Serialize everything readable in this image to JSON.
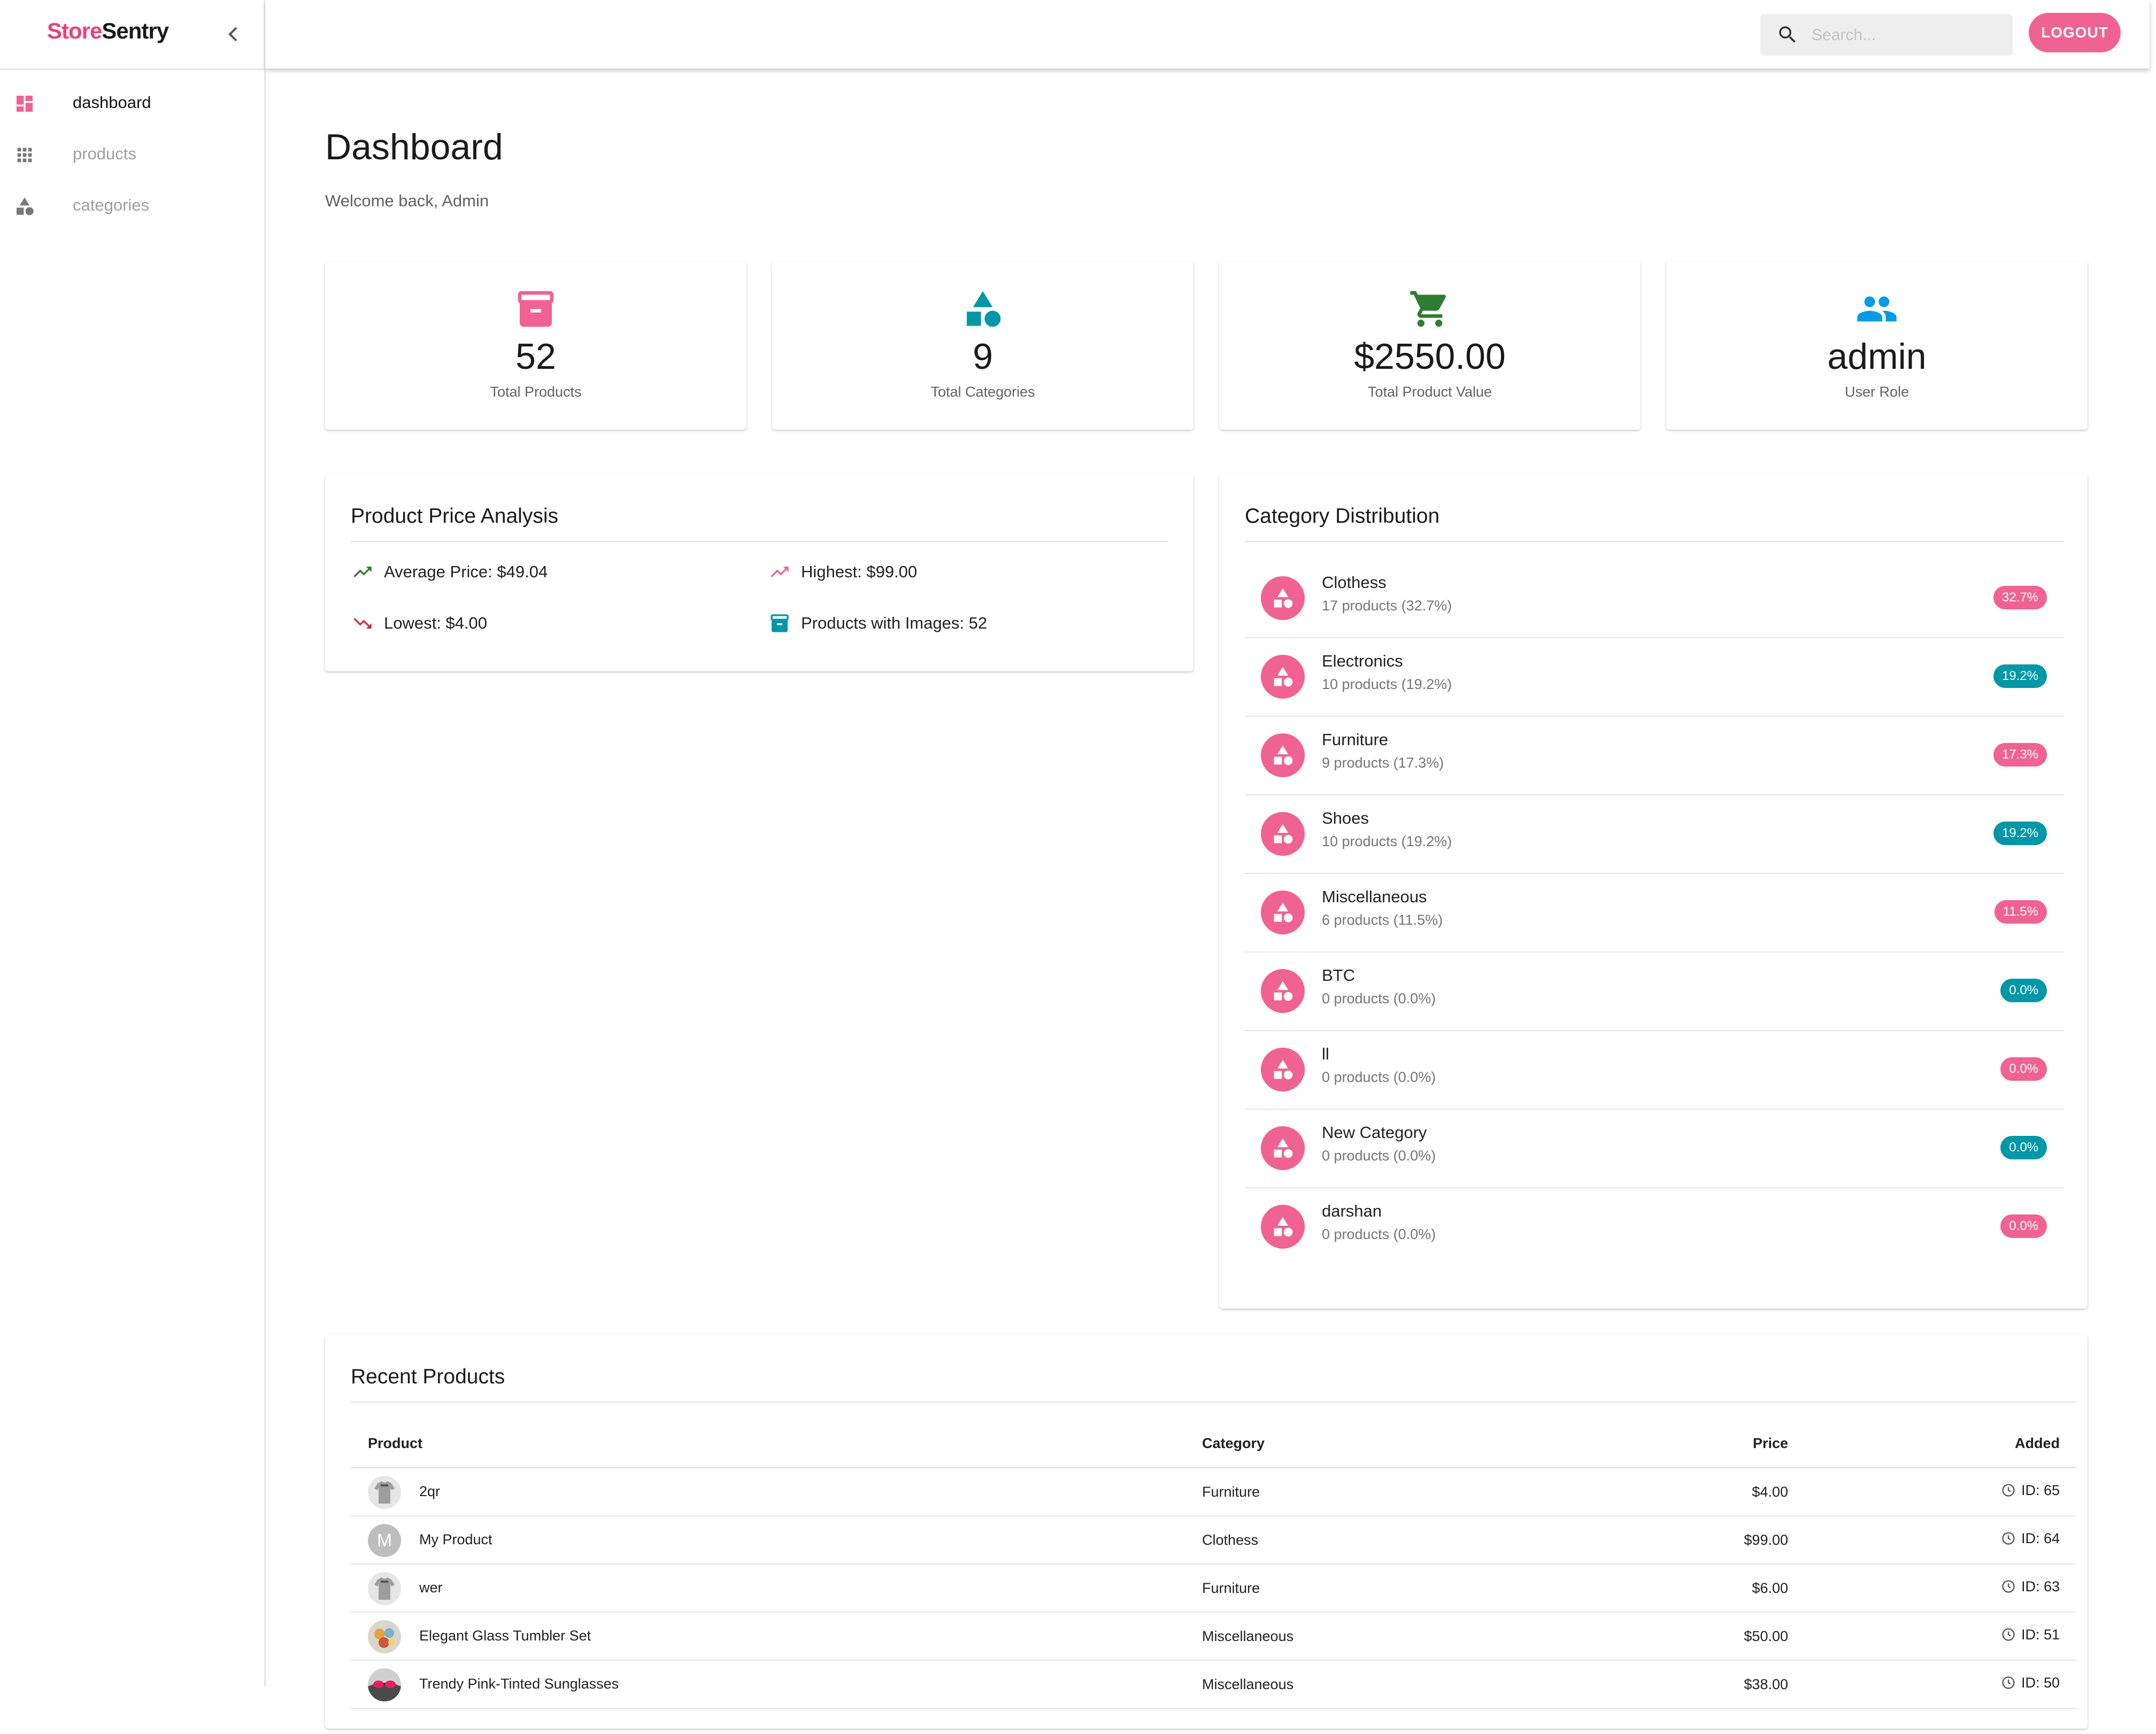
{
  "app": {
    "brand_part1": "Store",
    "brand_part2": "Sentry",
    "accent_color": "#f06292",
    "teal_color": "#0097a7"
  },
  "sidebar": {
    "items": [
      {
        "label": "dashboard",
        "icon": "dashboard-icon",
        "active": true
      },
      {
        "label": "products",
        "icon": "apps-grid-icon",
        "active": false
      },
      {
        "label": "categories",
        "icon": "category-shapes-icon",
        "active": false
      }
    ]
  },
  "topbar": {
    "search_placeholder": "Search...",
    "logout_label": "LOGOUT"
  },
  "header": {
    "title": "Dashboard",
    "welcome": "Welcome back, Admin"
  },
  "stats": [
    {
      "value": "52",
      "label": "Total Products",
      "icon": "inventory-box-icon",
      "color": "#f06292"
    },
    {
      "value": "9",
      "label": "Total Categories",
      "icon": "category-shapes-icon",
      "color": "#0097a7"
    },
    {
      "value": "$2550.00",
      "label": "Total Product Value",
      "icon": "shopping-cart-icon",
      "color": "#2e7d32"
    },
    {
      "value": "admin",
      "label": "User Role",
      "icon": "people-icon",
      "color": "#039be5"
    }
  ],
  "price_analysis": {
    "title": "Product Price Analysis",
    "items": [
      {
        "text": "Average Price: $49.04",
        "icon": "trending-up-icon",
        "color": "#2e7d32"
      },
      {
        "text": "Highest: $99.00",
        "icon": "trending-up-icon",
        "color": "#f06292"
      },
      {
        "text": "Lowest: $4.00",
        "icon": "trending-down-icon",
        "color": "#d32f2f"
      },
      {
        "text": "Products with Images: 52",
        "icon": "inventory-box-icon",
        "color": "#0097a7"
      }
    ]
  },
  "category_distribution": {
    "title": "Category Distribution",
    "items": [
      {
        "name": "Clothess",
        "sub": "17 products (32.7%)",
        "badge": "32.7%",
        "badge_color": "#f06292"
      },
      {
        "name": "Electronics",
        "sub": "10 products (19.2%)",
        "badge": "19.2%",
        "badge_color": "#0097a7"
      },
      {
        "name": "Furniture",
        "sub": "9 products (17.3%)",
        "badge": "17.3%",
        "badge_color": "#f06292"
      },
      {
        "name": "Shoes",
        "sub": "10 products (19.2%)",
        "badge": "19.2%",
        "badge_color": "#0097a7"
      },
      {
        "name": "Miscellaneous",
        "sub": "6 products (11.5%)",
        "badge": "11.5%",
        "badge_color": "#f06292"
      },
      {
        "name": "BTC",
        "sub": "0 products (0.0%)",
        "badge": "0.0%",
        "badge_color": "#0097a7"
      },
      {
        "name": "ll",
        "sub": "0 products (0.0%)",
        "badge": "0.0%",
        "badge_color": "#f06292"
      },
      {
        "name": "New Category",
        "sub": "0 products (0.0%)",
        "badge": "0.0%",
        "badge_color": "#0097a7"
      },
      {
        "name": "darshan",
        "sub": "0 products (0.0%)",
        "badge": "0.0%",
        "badge_color": "#f06292"
      }
    ]
  },
  "recent_products": {
    "title": "Recent Products",
    "columns": {
      "product": "Product",
      "category": "Category",
      "price": "Price",
      "added": "Added"
    },
    "rows": [
      {
        "name": "2qr",
        "category": "Furniture",
        "price": "$4.00",
        "added": "ID: 65",
        "thumb": "tshirt-thumbnail"
      },
      {
        "name": "My Product",
        "category": "Clothess",
        "price": "$99.00",
        "added": "ID: 64",
        "thumb": "letter-avatar",
        "initial": "M"
      },
      {
        "name": "wer",
        "category": "Furniture",
        "price": "$6.00",
        "added": "ID: 63",
        "thumb": "tshirt-thumbnail"
      },
      {
        "name": "Elegant Glass Tumbler Set",
        "category": "Miscellaneous",
        "price": "$50.00",
        "added": "ID: 51",
        "thumb": "tumbler-photo-thumbnail"
      },
      {
        "name": "Trendy Pink-Tinted Sunglasses",
        "category": "Miscellaneous",
        "price": "$38.00",
        "added": "ID: 50",
        "thumb": "sunglasses-photo-thumbnail"
      }
    ]
  }
}
